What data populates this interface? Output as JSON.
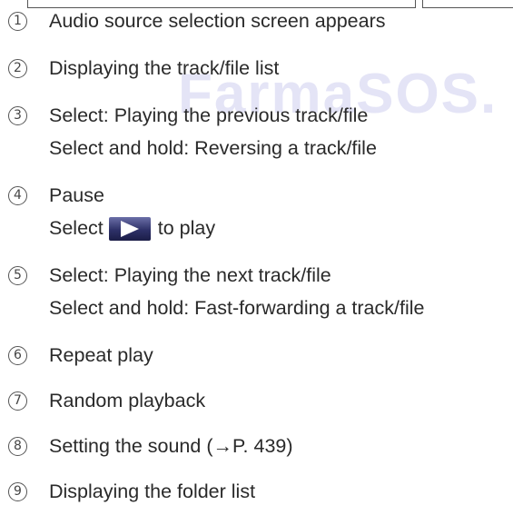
{
  "watermark": "FarmaSOS.",
  "items": [
    {
      "num": "1",
      "lines": [
        "Audio source selection screen appears"
      ]
    },
    {
      "num": "2",
      "lines": [
        "Displaying the track/file list"
      ]
    },
    {
      "num": "3",
      "lines": [
        "Select: Playing the previous track/file",
        "Select and hold: Reversing a track/file"
      ]
    },
    {
      "num": "4",
      "lines": [
        "Pause"
      ],
      "select_prefix": "Select",
      "select_suffix": "to play",
      "play_icon": "play-icon"
    },
    {
      "num": "5",
      "lines": [
        "Select: Playing the next track/file",
        "Select and hold: Fast-forwarding a track/file"
      ]
    },
    {
      "num": "6",
      "lines": [
        "Repeat play"
      ]
    },
    {
      "num": "7",
      "lines": [
        "Random playback"
      ]
    },
    {
      "num": "8",
      "lines": [
        "Setting the sound (→P. 439)"
      ]
    },
    {
      "num": "9",
      "lines": [
        "Displaying the folder list"
      ]
    }
  ]
}
